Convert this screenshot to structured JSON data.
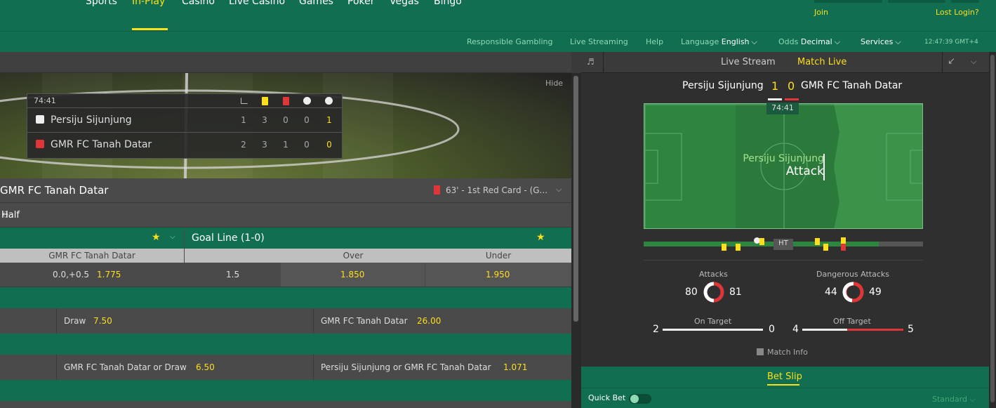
{
  "nav": {
    "items": [
      "Sports",
      "In-Play",
      "Casino",
      "Live Casino",
      "Games",
      "Poker",
      "Vegas",
      "Bingo"
    ],
    "active": "In-Play"
  },
  "account": {
    "join": "Join",
    "lost_login": "Lost Login?"
  },
  "subnav": {
    "responsible": "Responsible Gambling",
    "live_streaming": "Live Streaming",
    "help": "Help",
    "language_label": "Language",
    "language_value": "English",
    "odds_label": "Odds",
    "odds_value": "Decimal",
    "services": "Services",
    "clock": "12:47:39 GMT+4"
  },
  "media": {
    "hide": "Hide"
  },
  "scoreboard": {
    "time": "74:41",
    "teams": [
      {
        "name": "Persiju Sijunjung",
        "corners": "1",
        "yellow": "3",
        "red": "0",
        "subs": "0",
        "goals": "1"
      },
      {
        "name": "GMR FC Tanah Datar",
        "corners": "2",
        "yellow": "3",
        "red": "1",
        "subs": "0",
        "goals": "0"
      }
    ]
  },
  "match": {
    "title": "GMR FC Tanah Datar",
    "event": "63' - 1st Red Card - (G...",
    "period": "Half"
  },
  "markets": {
    "goal_line": "Goal Line (1-0)",
    "left_col": "GMR FC Tanah Datar",
    "over": "Over",
    "under": "Under",
    "left_handicap": "0.0,+0.5",
    "left_odds": "1.775",
    "line": "1.5",
    "over_odds": "1.850",
    "under_odds": "1.950",
    "draw_label": "Draw",
    "draw_odds": "7.50",
    "away_label": "GMR FC Tanah Datar",
    "away_odds": "26.00",
    "dc1_label": "GMR FC Tanah Datar or Draw",
    "dc1_odds": "6.50",
    "dc2_label": "Persiju Sijunjung or GMR FC Tanah Datar",
    "dc2_odds": "1.071"
  },
  "right": {
    "live_stream": "Live Stream",
    "match_live": "Match Live",
    "home": "Persiju Sijunjung",
    "away": "GMR FC Tanah Datar",
    "home_score": "1",
    "away_score": "0",
    "time": "74:41",
    "attack_team": "Persiju Sijunjung",
    "attack_label": "Attack",
    "ht": "HT",
    "stats": {
      "attacks_label": "Attacks",
      "attacks_home": "80",
      "attacks_away": "81",
      "dangerous_label": "Dangerous Attacks",
      "dangerous_home": "44",
      "dangerous_away": "49",
      "on_target_label": "On Target",
      "on_target_home": "2",
      "on_target_away": "0",
      "off_target_label": "Off Target",
      "off_target_home": "4",
      "off_target_away": "5"
    },
    "match_info": "Match Info",
    "bet_slip": "Bet Slip",
    "quick_bet": "Quick Bet",
    "standard": "Standard"
  },
  "colors": {
    "brand": "#126e51",
    "accent": "#ffdf1b",
    "red": "#e13637"
  }
}
